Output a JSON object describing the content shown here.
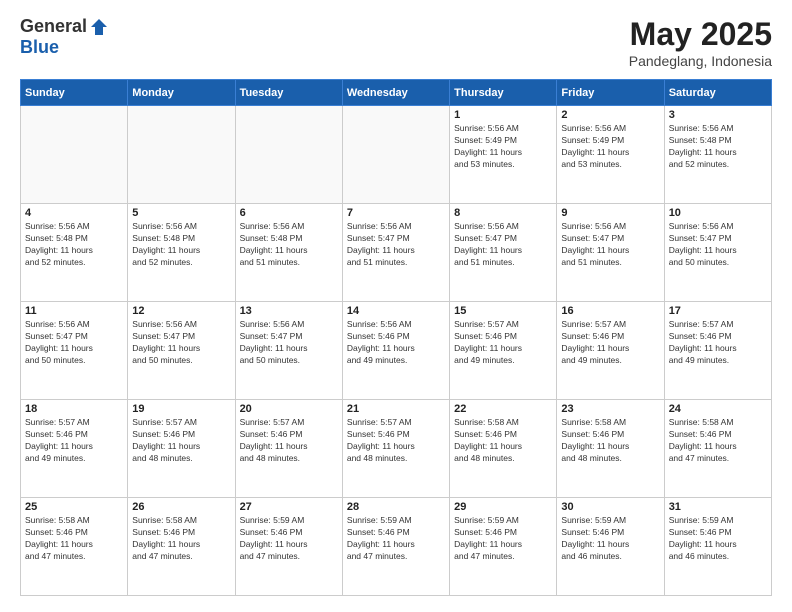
{
  "logo": {
    "general": "General",
    "blue": "Blue"
  },
  "title": "May 2025",
  "location": "Pandeglang, Indonesia",
  "headers": [
    "Sunday",
    "Monday",
    "Tuesday",
    "Wednesday",
    "Thursday",
    "Friday",
    "Saturday"
  ],
  "weeks": [
    [
      {
        "day": "",
        "text": ""
      },
      {
        "day": "",
        "text": ""
      },
      {
        "day": "",
        "text": ""
      },
      {
        "day": "",
        "text": ""
      },
      {
        "day": "1",
        "text": "Sunrise: 5:56 AM\nSunset: 5:49 PM\nDaylight: 11 hours\nand 53 minutes."
      },
      {
        "day": "2",
        "text": "Sunrise: 5:56 AM\nSunset: 5:49 PM\nDaylight: 11 hours\nand 53 minutes."
      },
      {
        "day": "3",
        "text": "Sunrise: 5:56 AM\nSunset: 5:48 PM\nDaylight: 11 hours\nand 52 minutes."
      }
    ],
    [
      {
        "day": "4",
        "text": "Sunrise: 5:56 AM\nSunset: 5:48 PM\nDaylight: 11 hours\nand 52 minutes."
      },
      {
        "day": "5",
        "text": "Sunrise: 5:56 AM\nSunset: 5:48 PM\nDaylight: 11 hours\nand 52 minutes."
      },
      {
        "day": "6",
        "text": "Sunrise: 5:56 AM\nSunset: 5:48 PM\nDaylight: 11 hours\nand 51 minutes."
      },
      {
        "day": "7",
        "text": "Sunrise: 5:56 AM\nSunset: 5:47 PM\nDaylight: 11 hours\nand 51 minutes."
      },
      {
        "day": "8",
        "text": "Sunrise: 5:56 AM\nSunset: 5:47 PM\nDaylight: 11 hours\nand 51 minutes."
      },
      {
        "day": "9",
        "text": "Sunrise: 5:56 AM\nSunset: 5:47 PM\nDaylight: 11 hours\nand 51 minutes."
      },
      {
        "day": "10",
        "text": "Sunrise: 5:56 AM\nSunset: 5:47 PM\nDaylight: 11 hours\nand 50 minutes."
      }
    ],
    [
      {
        "day": "11",
        "text": "Sunrise: 5:56 AM\nSunset: 5:47 PM\nDaylight: 11 hours\nand 50 minutes."
      },
      {
        "day": "12",
        "text": "Sunrise: 5:56 AM\nSunset: 5:47 PM\nDaylight: 11 hours\nand 50 minutes."
      },
      {
        "day": "13",
        "text": "Sunrise: 5:56 AM\nSunset: 5:47 PM\nDaylight: 11 hours\nand 50 minutes."
      },
      {
        "day": "14",
        "text": "Sunrise: 5:56 AM\nSunset: 5:46 PM\nDaylight: 11 hours\nand 49 minutes."
      },
      {
        "day": "15",
        "text": "Sunrise: 5:57 AM\nSunset: 5:46 PM\nDaylight: 11 hours\nand 49 minutes."
      },
      {
        "day": "16",
        "text": "Sunrise: 5:57 AM\nSunset: 5:46 PM\nDaylight: 11 hours\nand 49 minutes."
      },
      {
        "day": "17",
        "text": "Sunrise: 5:57 AM\nSunset: 5:46 PM\nDaylight: 11 hours\nand 49 minutes."
      }
    ],
    [
      {
        "day": "18",
        "text": "Sunrise: 5:57 AM\nSunset: 5:46 PM\nDaylight: 11 hours\nand 49 minutes."
      },
      {
        "day": "19",
        "text": "Sunrise: 5:57 AM\nSunset: 5:46 PM\nDaylight: 11 hours\nand 48 minutes."
      },
      {
        "day": "20",
        "text": "Sunrise: 5:57 AM\nSunset: 5:46 PM\nDaylight: 11 hours\nand 48 minutes."
      },
      {
        "day": "21",
        "text": "Sunrise: 5:57 AM\nSunset: 5:46 PM\nDaylight: 11 hours\nand 48 minutes."
      },
      {
        "day": "22",
        "text": "Sunrise: 5:58 AM\nSunset: 5:46 PM\nDaylight: 11 hours\nand 48 minutes."
      },
      {
        "day": "23",
        "text": "Sunrise: 5:58 AM\nSunset: 5:46 PM\nDaylight: 11 hours\nand 48 minutes."
      },
      {
        "day": "24",
        "text": "Sunrise: 5:58 AM\nSunset: 5:46 PM\nDaylight: 11 hours\nand 47 minutes."
      }
    ],
    [
      {
        "day": "25",
        "text": "Sunrise: 5:58 AM\nSunset: 5:46 PM\nDaylight: 11 hours\nand 47 minutes."
      },
      {
        "day": "26",
        "text": "Sunrise: 5:58 AM\nSunset: 5:46 PM\nDaylight: 11 hours\nand 47 minutes."
      },
      {
        "day": "27",
        "text": "Sunrise: 5:59 AM\nSunset: 5:46 PM\nDaylight: 11 hours\nand 47 minutes."
      },
      {
        "day": "28",
        "text": "Sunrise: 5:59 AM\nSunset: 5:46 PM\nDaylight: 11 hours\nand 47 minutes."
      },
      {
        "day": "29",
        "text": "Sunrise: 5:59 AM\nSunset: 5:46 PM\nDaylight: 11 hours\nand 47 minutes."
      },
      {
        "day": "30",
        "text": "Sunrise: 5:59 AM\nSunset: 5:46 PM\nDaylight: 11 hours\nand 46 minutes."
      },
      {
        "day": "31",
        "text": "Sunrise: 5:59 AM\nSunset: 5:46 PM\nDaylight: 11 hours\nand 46 minutes."
      }
    ]
  ]
}
